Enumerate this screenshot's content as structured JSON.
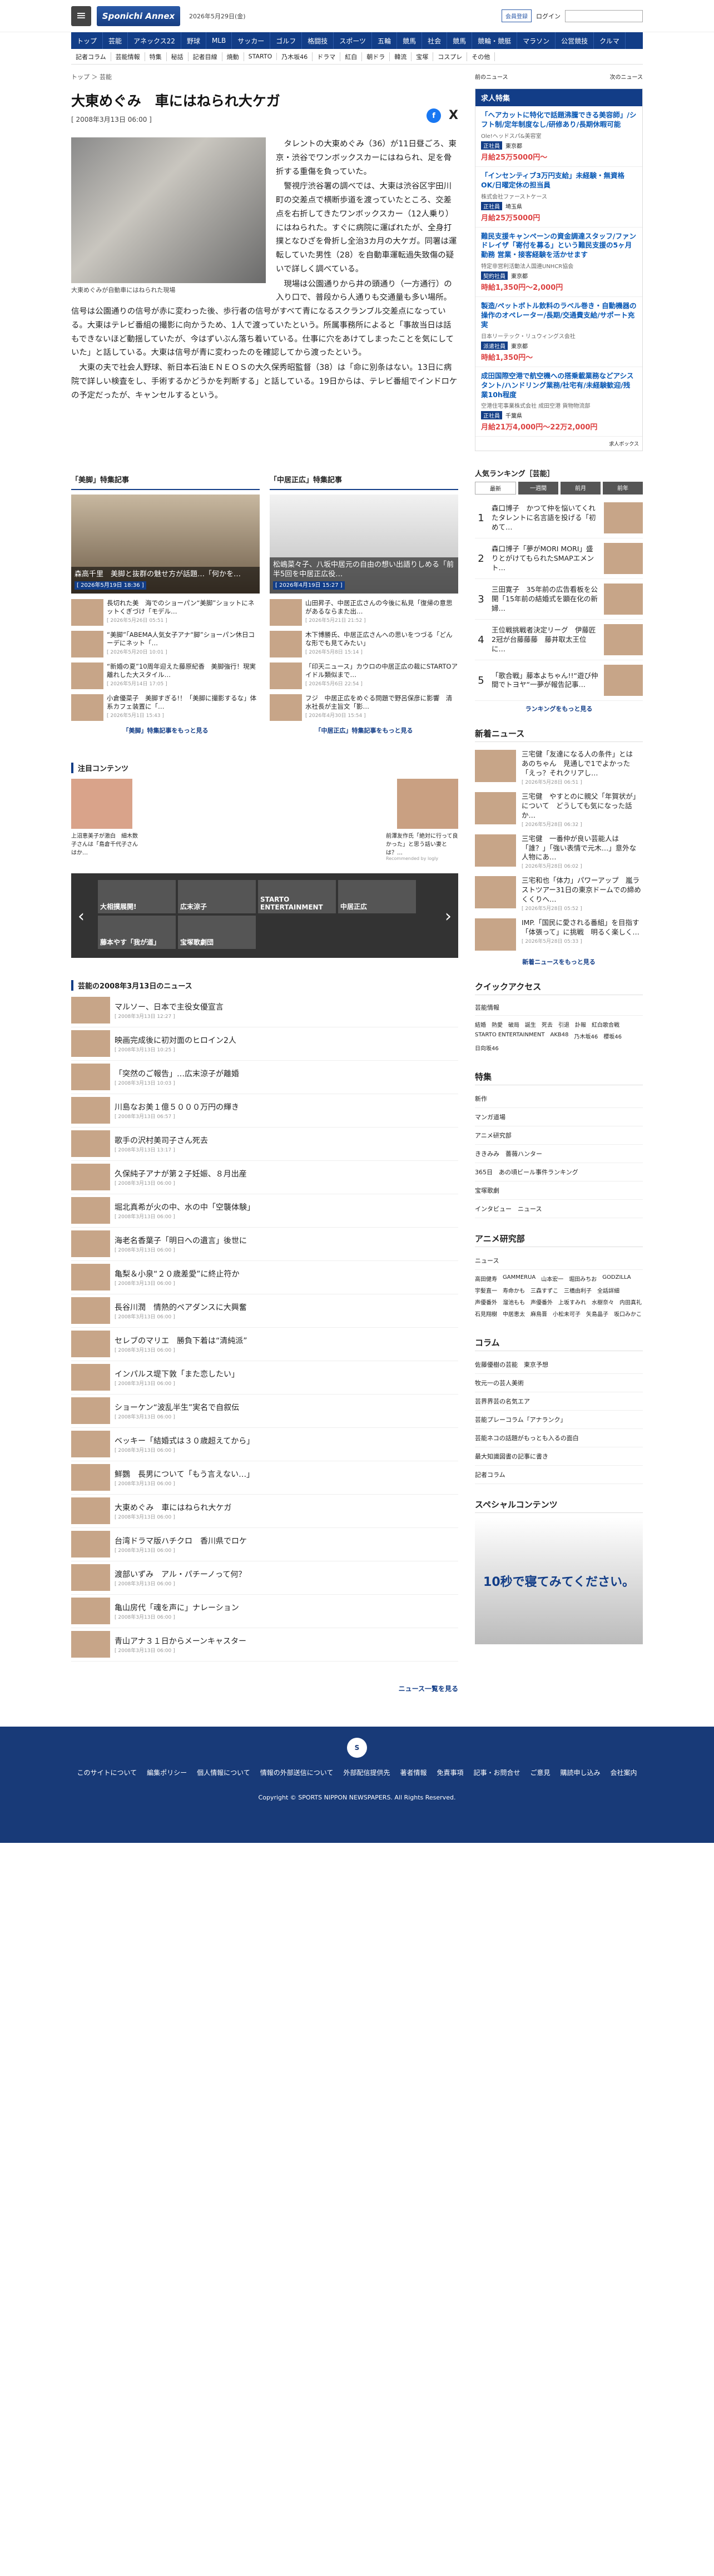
{
  "header": {
    "logo": "Sponichi Annex",
    "date": "2026年5月29日(金)",
    "member": "会員登録",
    "login": "ログイン"
  },
  "gnav": [
    "トップ",
    "芸能",
    "アネックス22",
    "野球",
    "MLB",
    "サッカー",
    "ゴルフ",
    "格闘技",
    "スポーツ",
    "五輪",
    "競馬",
    "社会",
    "競馬",
    "競輪・競艇",
    "マラソン",
    "公営競技",
    "クルマ"
  ],
  "snav": [
    "記者コラム",
    "芸能情報",
    "特集",
    "秘話",
    "記者目線",
    "焼動",
    "STARTO",
    "乃木坂46",
    "ドラマ",
    "紅白",
    "朝ドラ",
    "韓流",
    "宝塚",
    "コスプレ",
    "その他"
  ],
  "breadcrumb": "トップ ＞ 芸能",
  "prev": "前のニュース",
  "next": "次のニュース",
  "article": {
    "title": "大東めぐみ　車にはねられ大ケガ",
    "published": "[ 2008年3月13日 06:00 ]",
    "caption": "大東めぐみが自動車にはねられた現場",
    "p1": "　タレントの大東めぐみ（36）が11日昼ごろ、東京・渋谷でワンボックスカーにはねられ、足を骨折する重傷を負っていた。",
    "p2": "　警視庁渋谷署の調べでは、大東は渋谷区宇田川町の交差点で横断歩道を渡っていたところ、交差点を右折してきたワンボックスカー（12人乗り）にはねられた。すぐに病院に運ばれたが、全身打撲となひざを骨折し全治3カ月の大ケガ。同署は運転していた男性（28）を自動車運転過失致傷の疑いで詳しく調べている。",
    "p3": "　現場は公園通りから井の頭通り（一方通行）の入り口で、普段から人通りも交通量も多い場所。信号は公園通りの信号が赤に変わった後、歩行者の信号がすべて青になるスクランブル交差点になっている。大東はテレビ番組の撮影に向かうため、1人で渡っていたという。所属事務所によると「事故当日は話もできないほど動揺していたが、今はずいぶん落ち着いている。仕事に穴をあけてしまったことを気にしていた」と話している。大東は信号が青に変わったのを確認してから渡ったという。",
    "p4": "　大東の夫で社会人野球、新日本石油ＥＮＥＯＳの大久保秀昭監督（38）は「命に別条はない。13日に病院で詳しい検査をし、手術するかどうかを判断する」と話している。19日からは、テレビ番組でインドロケの予定だったが、キャンセルするという。"
  },
  "features": {
    "head": "特集記事",
    "col1": {
      "title": "「美脚」特集記事",
      "feat": "森高千里　美脚と抜群の魅せ方が話題…「何かを…",
      "feat_date": "[ 2026年5月19日 18:36 ]",
      "items": [
        {
          "t": "長切れた美　海でのショーパン“美脚”ショットにネットくぎづけ「モデル…",
          "d": "[ 2026年5月26日 05:51 ]"
        },
        {
          "t": "“美脚”「ABEMA人気女子アナ“脚”ショーパン休日コーデにネット「…",
          "d": "[ 2026年5月20日 10:01 ]"
        },
        {
          "t": "“新婚の夏”10周年迎えた藤原紀香　美脚強行！現実離れした大スタイル…",
          "d": "[ 2026年5月14日 17:05 ]"
        },
        {
          "t": "小倉優菜子　美脚すぎる!！「美脚に撮影するな」体系カフェ装置に「…",
          "d": "[ 2026年5月1日 15:43 ]"
        }
      ],
      "more": "「美脚」特集記事をもっと見る"
    },
    "col2": {
      "title": "「中居正広」特集記事",
      "feat": "松嶋菜々子、八坂中居元の自由の想い出語りしめる「前半5回を中居正広役…",
      "feat_date": "[ 2026年4月19日 15:27 ]",
      "items": [
        {
          "t": "山田昇子、中居正広さんの今後に私見「復帰の意思があるならまた出…",
          "d": "[ 2026年5月21日 21:52 ]"
        },
        {
          "t": "木下博勝氏、中居正広さんへの思いをつづる「どんな形でも見てみたい」",
          "d": "[ 2026年5月8日 15:14 ]"
        },
        {
          "t": "「印天ニュース」カウロの中居正広の裁にSTARTOアイドル類似まで…",
          "d": "[ 2026年5月6日 22:54 ]"
        },
        {
          "t": "フジ　中居正広をめぐる問題で野呂保彦に影響　清水社長が主旨文「影…",
          "d": "[ 2026年4月30日 15:54 ]"
        }
      ],
      "more": "「中居正広」特集記事をもっと見る"
    }
  },
  "attention": {
    "head": "注目コンテンツ",
    "left": "上沼恵美子が激白　細木数子さんは「島倉千代子さんはか…",
    "right": "前澤友作氏「絶対に行って良かった」と思う話い妻とは？…",
    "provider": "Recommended by logly"
  },
  "carousel": [
    "大相撲展開!",
    "広末涼子",
    "STARTO ENTERTAINMENT",
    "中居正広",
    "藤本やす「我が道」",
    "宝塚歌劇団"
  ],
  "daylist": {
    "head": "芸能の2008年3月13日のニュース",
    "items": [
      {
        "t": "マルソー、日本で主役女優宣言",
        "d": "[ 2008年3月13日 12:27 ]"
      },
      {
        "t": "映画完成後に初対面のヒロイン2人",
        "d": "[ 2008年3月13日 10:25 ]"
      },
      {
        "t": "「突然のご報告」…広末涼子が離婚",
        "d": "[ 2008年3月13日 10:03 ]"
      },
      {
        "t": "川島なお美１億５０００万円の輝き",
        "d": "[ 2008年3月13日 06:57 ]"
      },
      {
        "t": "歌手の沢村美司子さん死去",
        "d": "[ 2008年3月13日 13:17 ]"
      },
      {
        "t": "久保純子アナが第２子妊娠、８月出産",
        "d": "[ 2008年3月13日 06:00 ]"
      },
      {
        "t": "堀北真希が火の中、水の中「空襲体験」",
        "d": "[ 2008年3月13日 06:00 ]"
      },
      {
        "t": "海老名香葉子「明日への遺言」後世に",
        "d": "[ 2008年3月13日 06:00 ]"
      },
      {
        "t": "亀梨＆小泉“２０歳差愛”に終止符か",
        "d": "[ 2008年3月13日 06:00 ]"
      },
      {
        "t": "長谷川潤　情熱的ペアダンスに大興奮",
        "d": "[ 2008年3月13日 06:00 ]"
      },
      {
        "t": "セレブのマリエ　勝負下着は“清純派”",
        "d": "[ 2008年3月13日 06:00 ]"
      },
      {
        "t": "インパルス堤下敦「また恋したい」",
        "d": "[ 2008年3月13日 06:00 ]"
      },
      {
        "t": "ショーケン“波乱半生”実名で自叙伝",
        "d": "[ 2008年3月13日 06:00 ]"
      },
      {
        "t": "ベッキー「結婚式は３０歳超えてから」",
        "d": "[ 2008年3月13日 06:00 ]"
      },
      {
        "t": "鮮鸚　長男について「もう言えない…」",
        "d": "[ 2008年3月13日 06:00 ]"
      },
      {
        "t": "大東めぐみ　車にはねられ大ケガ",
        "d": "[ 2008年3月13日 06:00 ]"
      },
      {
        "t": "台湾ドラマ版ハチクロ　香川県でロケ",
        "d": "[ 2008年3月13日 06:00 ]"
      },
      {
        "t": "渡部いずみ　アル・パチーノって何？",
        "d": "[ 2008年3月13日 06:00 ]"
      },
      {
        "t": "亀山房代「魂を声に」ナレーション",
        "d": "[ 2008年3月13日 06:00 ]"
      },
      {
        "t": "青山アナ３１日からメーンキャスター",
        "d": "[ 2008年3月13日 06:00 ]"
      }
    ],
    "more": "ニュース一覧を見る"
  },
  "side": {
    "jobs_head": "求人特集",
    "jobs": [
      {
        "t": "「ヘアカットに特化で話題沸騰できる美容師」/シフト制/定年制度なし/研修あり/長期休暇可能",
        "c": "Ole!ヘッドスパ&美容室",
        "tag": "正社員",
        "loc": "東京都",
        "pay": "月給25万5000円～"
      },
      {
        "t": "「インセンティブ3万円支給」未経験・無資格OK/日曜定休の担当員",
        "c": "株式会社ファーストケース",
        "tag": "正社員",
        "loc": "埼玉県",
        "pay": "月給25万5000円"
      },
      {
        "t": "難民支援キャンペーンの資金調達スタッフ/ファンドレイザ「寄付を募る」という難民支援の5ヶ月勤務 営業・接客経験を活かせます",
        "c": "特定非営利活動法人国連UNHCR協会",
        "tag": "契約社員",
        "loc": "東京都",
        "pay": "時給1,350円～2,000円"
      },
      {
        "t": "製造/ペットボトル飲料のラベル巻き・自動機器の操作のオペレーター/長期/交通費支給/サポート充実",
        "c": "日本リーテック・リュウィングス会社",
        "tag": "派遣社員",
        "loc": "東京都",
        "pay": "時給1,350円～"
      },
      {
        "t": "成田国際空港で航空機への搭乗載業務などアシスタント/ハンドリング業務/社宅有/未経験歓迎/残業10h程度",
        "c": "空港住宅事業株式会社 成田空港 貨物物流部",
        "tag": "正社員",
        "loc": "千葉県",
        "pay": "月給21万4,000円～22万2,000円"
      }
    ],
    "jobs_more": "求人ボックス",
    "rank_head": "人気ランキング［芸能］",
    "rank_tabs": [
      "最新",
      "一週間",
      "前月",
      "前年"
    ],
    "rank": [
      {
        "n": "1",
        "t": "森口博子　かつて仲を悩いてくれたタレントに名言語を投げる「初めて…"
      },
      {
        "n": "2",
        "t": "森口博子「夢がMORI MORI」盛りとがけてもられたSMAPエメント…"
      },
      {
        "n": "3",
        "t": "三田寛子　35年前の広告看板を公開「15年前の結婚式を顕在化の新婦…"
      },
      {
        "n": "4",
        "t": "王位戦挑戦者決定リーグ　伊藤匠2冠が台藤藤藤　藤井取太王位に…"
      },
      {
        "n": "5",
        "t": "「歌合戦」藤本よちゃん!!“遊び仲間でトヨヤ“一夢が報告記事…"
      }
    ],
    "rank_more": "ランキングをもっと見る",
    "new_head": "新着ニュース",
    "news": [
      {
        "t": "三宅健「友達になる人の条件」とは　あのちゃん　見通しで1でよかった　「えっ？それクリアし…",
        "d": "[ 2026年5月28日 06:51 ]"
      },
      {
        "t": "三宅健　やすとのに親父「年賀状が」について　どうしても気になった話か…",
        "d": "[ 2026年5月28日 06:32 ]"
      },
      {
        "t": "三宅健　一番仲が良い芸能人は「誰？」「強い表情で元木…」意外な人物にあ…",
        "d": "[ 2026年5月28日 06:02 ]"
      },
      {
        "t": "三宅和也「体力」パワーアップ　嵐ラストツアー31日の東京ドームでの締めくくりへ…",
        "d": "[ 2026年5月28日 05:52 ]"
      },
      {
        "t": "IMP.「国民に愛される番組」を目指す「体張って」に挑戦　明るく楽しく…",
        "d": "[ 2026年5月28日 05:33 ]"
      }
    ],
    "news_more": "新着ニュースをもっと見る",
    "qa_head": "クイックアクセス",
    "qa": "芸能情報",
    "qa_tags": [
      "結婚",
      "熱愛",
      "破局",
      "誕生",
      "死去",
      "引退",
      "訃報",
      "紅白歌合戦",
      "STARTO ENTERTAINMENT",
      "AKB48",
      "乃木坂46",
      "櫻坂46",
      "日向坂46"
    ],
    "special_head": "特集",
    "special": [
      "新作",
      "マンガ道場",
      "アニメ研究部",
      "ききみみ　薔薇ハンター",
      "365日　あの頃ビール事件ランキング",
      "宝塚歌劇",
      "インタビュー　ニュース"
    ],
    "anime_head": "アニメ研究部",
    "anime_sub": "ニュース",
    "anime_tags": [
      "高田健寿",
      "GAMMERUA",
      "山本宏一",
      "堀田みちお",
      "GODZILLA",
      "宇髪直一",
      "寿命かも",
      "三森すずこ",
      "三橋由利子",
      "全話詳細",
      "声優番外",
      "溜池もも",
      "声優番外",
      "上坂すみれ",
      "水樹奈々",
      "内田真礼",
      "石見翔樹",
      "中居恵太",
      "麻鳥晋",
      "小松未可子",
      "矢島晶子",
      "坂口みかこ"
    ],
    "column_head": "コラム",
    "columns": [
      "佐藤優樹の芸能　東京予想",
      "牧元一の芸人美術",
      "芸界界芸の名気エア",
      "芸能プレーコラム「アナランク」",
      "芸能ネコの話題がもっとも入るの面白",
      "最大知識図書の記事に書き",
      "記者コラム"
    ],
    "sp_head": "スペシャルコンテンツ",
    "sp_banner": "10秒で寝てみてください。"
  },
  "footer": {
    "links": [
      "このサイトについて",
      "編集ポリシー",
      "個人情報について",
      "情報の外部送信について",
      "外部配信提供先",
      "著者情報",
      "免責事項",
      "記事・お問合せ",
      "ご意見",
      "購読申し込み",
      "会社案内"
    ],
    "copy": "Copyright © SPORTS NIPPON NEWSPAPERS. All Rights Reserved."
  }
}
